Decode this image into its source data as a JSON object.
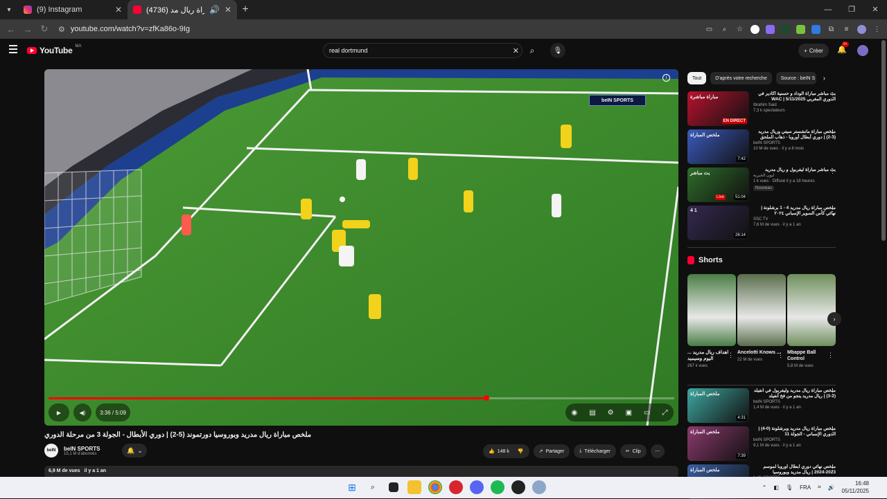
{
  "browser": {
    "tabs": [
      {
        "title": "(9) Instagram",
        "favicon": "instagram-icon",
        "active": false
      },
      {
        "title": "(4736) ملخص مباراة ريال مد...",
        "favicon": "youtube-icon",
        "active": true
      }
    ],
    "url": "youtube.com/watch?v=zfKa86o-9Ig"
  },
  "youtube": {
    "logo_text": "YouTube",
    "country_code": "MA",
    "search_value": "real dortmund",
    "create_label": "Créer",
    "notif_count": "9+"
  },
  "player": {
    "watermark": "beIN SPORTS",
    "time": "3:36 / 5:09",
    "progress": 0.7
  },
  "video": {
    "title": "ملخص مباراة ريال مدريد وبوروسيا دورتموند (5-2) | دوري الأبطال - الجولة 3 من مرحلة الدوري",
    "channel": "beIN SPORTS",
    "channel_logo_text": "beIN",
    "subscribers": "15,1 M d'abonnés",
    "likes": "148 k",
    "share_label": "Partager",
    "download_label": "Télécharger",
    "clip_label": "Clip",
    "views": "6,9 M de vues",
    "age": "il y a 1 an"
  },
  "sidebar": {
    "chips": [
      "Tout",
      "D'après votre recherche",
      "Source : beIN S"
    ],
    "recs": [
      {
        "title": "بث مباشر مباراة الوداد و حسنية أكادير في الدوري المغربي WAC | 5/11/2025",
        "channel": "Ibrahim Said",
        "stats": "7,3 k spectateurs",
        "badge": "EN DIRECT",
        "badge_type": "live",
        "thumb_text": "مباراة مباشرة",
        "color": "#b8122e"
      },
      {
        "title": "ملخص مباراة مانشستر سيتي وريال مدريد (3-2) | دوري أبطال أوروبا - ذهاب الملحق",
        "channel": "beIN SPORTS",
        "stats": "10 M de vues · il y a 8 mois",
        "badge": "7:42",
        "badge_type": "duration",
        "thumb_text": "ملخص المباراة",
        "color": "#3b5bbf"
      },
      {
        "title": "بث مباشر مباراة ليفربول و ريال مدريد",
        "channel": "ليون الخيرية",
        "stats": "1 k vues · Diffusé il y a 18 heures",
        "badge": "51:04",
        "badge_type": "duration",
        "thumb_text": "بث مباشر",
        "color": "#2f6d2a",
        "tag": "Nouveau",
        "live_tag": "Live"
      },
      {
        "title": "ملخص مباراة ريال مدريد 4 - 1 برشلونة | نهائي كأس السوبر الإسباني ٢٠٢٤",
        "channel": "SSC TV",
        "stats": "7,6 M de vues · il y a 1 an",
        "badge": "26:14",
        "badge_type": "duration",
        "thumb_text": "4 1",
        "color": "#34294f"
      }
    ],
    "shorts_label": "Shorts",
    "shorts": [
      {
        "title": "اهداف ريال مدريد ... اليوم وسيميد",
        "views": "267 k vues",
        "color": "#4a7d45"
      },
      {
        "title": "Ancelotti Knows ...",
        "views": "22 M de vues",
        "color": "#5a6e4c"
      },
      {
        "title": "Mbappe Ball Control",
        "views": "5,8 M de vues",
        "color": "#6e8f5c"
      }
    ],
    "recs2": [
      {
        "title": "ملخص مباراة ريال مدريد وليفربول في أنفيلد (2-3) | ريال مدريد ينجو من فخ أنفيلد",
        "channel": "beIN SPORTS",
        "stats": "1,4 M de vues · il y a 1 an",
        "badge": "4:31",
        "thumb_text": "ملخص المباراة",
        "color": "#3fa7a0"
      },
      {
        "title": "ملخص مباراة ريال مدريد وبرشلونة (0-4) | الدوري الإسباني - الجولة 11",
        "channel": "beIN SPORTS",
        "stats": "9,1 M de vues · il y a 1 an",
        "badge": "7:39",
        "thumb_text": "ملخص المباراة",
        "color": "#8c3a6e"
      },
      {
        "title": "ملخص نهائي دوري أبطال أوروبا لموسم 2023-2024 | ريال مدريد وبوروسيا",
        "channel": "beIN SPORTS",
        "stats": "",
        "badge": "",
        "thumb_text": "ملخص المباراة",
        "color": "#3a5fa3"
      }
    ]
  },
  "taskbar": {
    "lang": "FRA",
    "time": "16:48",
    "date": "05/11/2025"
  }
}
